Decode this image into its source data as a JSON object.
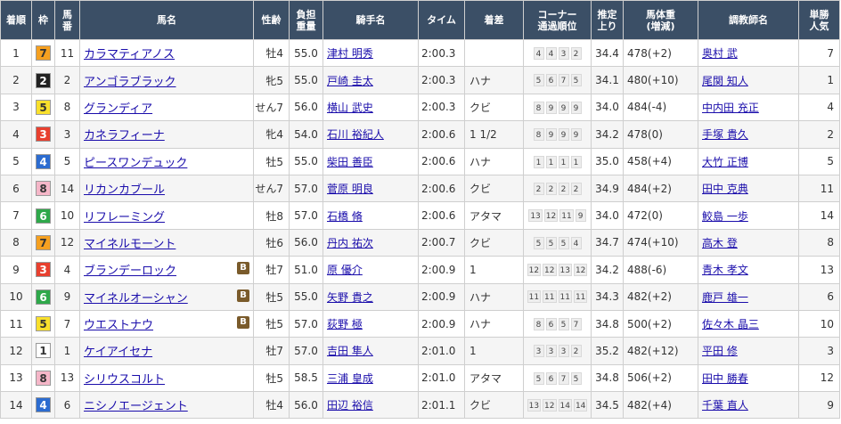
{
  "headers": {
    "rank": "着順",
    "waku": "枠",
    "umaban_top": "馬",
    "umaban_bottom": "番",
    "horse": "馬名",
    "sex_age": "性齢",
    "weight_top": "負担",
    "weight_bottom": "重量",
    "jockey": "騎手名",
    "time": "タイム",
    "margin": "着差",
    "corner_top": "コーナー",
    "corner_bottom": "通過順位",
    "last3f_top": "推定",
    "last3f_bottom": "上り",
    "body_top": "馬体重",
    "body_bottom": "(増減)",
    "trainer": "調教師名",
    "pop_top": "単勝",
    "pop_bottom": "人気"
  },
  "colors": {
    "header_bg": "#3b4f66",
    "link": "#1a0dab",
    "blinker_bg": "#7a5b2b",
    "waku": {
      "1": {
        "bg": "#ffffff",
        "fg": "#333333"
      },
      "2": {
        "bg": "#222222",
        "fg": "#ffffff"
      },
      "3": {
        "bg": "#e8402f",
        "fg": "#ffffff"
      },
      "4": {
        "bg": "#2c6cd0",
        "fg": "#ffffff"
      },
      "5": {
        "bg": "#f9e02c",
        "fg": "#333333"
      },
      "6": {
        "bg": "#2ea84a",
        "fg": "#ffffff"
      },
      "7": {
        "bg": "#f5a020",
        "fg": "#333333"
      },
      "8": {
        "bg": "#f5b6c8",
        "fg": "#333333"
      }
    }
  },
  "rows": [
    {
      "rank": "1",
      "waku": "7",
      "umaban": "11",
      "horse": "カラマティアノス",
      "blinker": "",
      "sex_age": "牡4",
      "weight": "55.0",
      "jockey": "津村 明秀",
      "time": "2:00.3",
      "margin": "",
      "corners": [
        "4",
        "4",
        "3",
        "2"
      ],
      "last3f": "34.4",
      "body": "478(+2)",
      "trainer": "奥村 武",
      "pop": "7"
    },
    {
      "rank": "2",
      "waku": "2",
      "umaban": "2",
      "horse": "アンゴラブラック",
      "blinker": "",
      "sex_age": "牝5",
      "weight": "55.0",
      "jockey": "戸崎 圭太",
      "time": "2:00.3",
      "margin": "ハナ",
      "corners": [
        "5",
        "6",
        "7",
        "5"
      ],
      "last3f": "34.1",
      "body": "480(+10)",
      "trainer": "尾関 知人",
      "pop": "1"
    },
    {
      "rank": "3",
      "waku": "5",
      "umaban": "8",
      "horse": "グランディア",
      "blinker": "",
      "sex_age": "せん7",
      "weight": "56.0",
      "jockey": "横山 武史",
      "time": "2:00.3",
      "margin": "クビ",
      "corners": [
        "8",
        "9",
        "9",
        "9"
      ],
      "last3f": "34.0",
      "body": "484(-4)",
      "trainer": "中内田 充正",
      "pop": "4"
    },
    {
      "rank": "4",
      "waku": "3",
      "umaban": "3",
      "horse": "カネラフィーナ",
      "blinker": "",
      "sex_age": "牝4",
      "weight": "54.0",
      "jockey": "石川 裕紀人",
      "time": "2:00.6",
      "margin": "1 1/2",
      "corners": [
        "8",
        "9",
        "9",
        "9"
      ],
      "last3f": "34.2",
      "body": "478(0)",
      "trainer": "手塚 貴久",
      "pop": "2"
    },
    {
      "rank": "5",
      "waku": "4",
      "umaban": "5",
      "horse": "ピースワンデュック",
      "blinker": "",
      "sex_age": "牡5",
      "weight": "55.0",
      "jockey": "柴田 善臣",
      "time": "2:00.6",
      "margin": "ハナ",
      "corners": [
        "1",
        "1",
        "1",
        "1"
      ],
      "last3f": "35.0",
      "body": "458(+4)",
      "trainer": "大竹 正博",
      "pop": "5"
    },
    {
      "rank": "6",
      "waku": "8",
      "umaban": "14",
      "horse": "リカンカブール",
      "blinker": "",
      "sex_age": "せん7",
      "weight": "57.0",
      "jockey": "菅原 明良",
      "time": "2:00.6",
      "margin": "クビ",
      "corners": [
        "2",
        "2",
        "2",
        "2"
      ],
      "last3f": "34.9",
      "body": "484(+2)",
      "trainer": "田中 克典",
      "pop": "11"
    },
    {
      "rank": "7",
      "waku": "6",
      "umaban": "10",
      "horse": "リフレーミング",
      "blinker": "",
      "sex_age": "牡8",
      "weight": "57.0",
      "jockey": "石橋 脩",
      "time": "2:00.6",
      "margin": "アタマ",
      "corners": [
        "13",
        "12",
        "11",
        "9"
      ],
      "last3f": "34.0",
      "body": "472(0)",
      "trainer": "鮫島 一歩",
      "pop": "14"
    },
    {
      "rank": "8",
      "waku": "7",
      "umaban": "12",
      "horse": "マイネルモーント",
      "blinker": "",
      "sex_age": "牡6",
      "weight": "56.0",
      "jockey": "丹内 祐次",
      "time": "2:00.7",
      "margin": "クビ",
      "corners": [
        "5",
        "5",
        "5",
        "4"
      ],
      "last3f": "34.7",
      "body": "474(+10)",
      "trainer": "高木 登",
      "pop": "8"
    },
    {
      "rank": "9",
      "waku": "3",
      "umaban": "4",
      "horse": "ブランデーロック",
      "blinker": "B",
      "sex_age": "牡7",
      "weight": "51.0",
      "jockey": "原 優介",
      "time": "2:00.9",
      "margin": "1",
      "corners": [
        "12",
        "12",
        "13",
        "12"
      ],
      "last3f": "34.2",
      "body": "488(-6)",
      "trainer": "青木 孝文",
      "pop": "13"
    },
    {
      "rank": "10",
      "waku": "6",
      "umaban": "9",
      "horse": "マイネルオーシャン",
      "blinker": "B",
      "sex_age": "牡5",
      "weight": "55.0",
      "jockey": "矢野 貴之",
      "time": "2:00.9",
      "margin": "ハナ",
      "corners": [
        "11",
        "11",
        "11",
        "11"
      ],
      "last3f": "34.3",
      "body": "482(+2)",
      "trainer": "鹿戸 雄一",
      "pop": "6"
    },
    {
      "rank": "11",
      "waku": "5",
      "umaban": "7",
      "horse": "ウエストナウ",
      "blinker": "B",
      "sex_age": "牡5",
      "weight": "57.0",
      "jockey": "荻野 極",
      "time": "2:00.9",
      "margin": "ハナ",
      "corners": [
        "8",
        "6",
        "5",
        "7"
      ],
      "last3f": "34.8",
      "body": "500(+2)",
      "trainer": "佐々木 晶三",
      "pop": "10"
    },
    {
      "rank": "12",
      "waku": "1",
      "umaban": "1",
      "horse": "ケイアイセナ",
      "blinker": "",
      "sex_age": "牡7",
      "weight": "57.0",
      "jockey": "吉田 隼人",
      "time": "2:01.0",
      "margin": "1",
      "corners": [
        "3",
        "3",
        "3",
        "2"
      ],
      "last3f": "35.2",
      "body": "482(+12)",
      "trainer": "平田 修",
      "pop": "3"
    },
    {
      "rank": "13",
      "waku": "8",
      "umaban": "13",
      "horse": "シリウスコルト",
      "blinker": "",
      "sex_age": "牡5",
      "weight": "58.5",
      "jockey": "三浦 皇成",
      "time": "2:01.0",
      "margin": "アタマ",
      "corners": [
        "5",
        "6",
        "7",
        "5"
      ],
      "last3f": "34.8",
      "body": "506(+2)",
      "trainer": "田中 勝春",
      "pop": "12"
    },
    {
      "rank": "14",
      "waku": "4",
      "umaban": "6",
      "horse": "ニシノエージェント",
      "blinker": "",
      "sex_age": "牡4",
      "weight": "56.0",
      "jockey": "田辺 裕信",
      "time": "2:01.1",
      "margin": "クビ",
      "corners": [
        "13",
        "12",
        "14",
        "14"
      ],
      "last3f": "34.5",
      "body": "482(+4)",
      "trainer": "千葉 直人",
      "pop": "9"
    }
  ]
}
